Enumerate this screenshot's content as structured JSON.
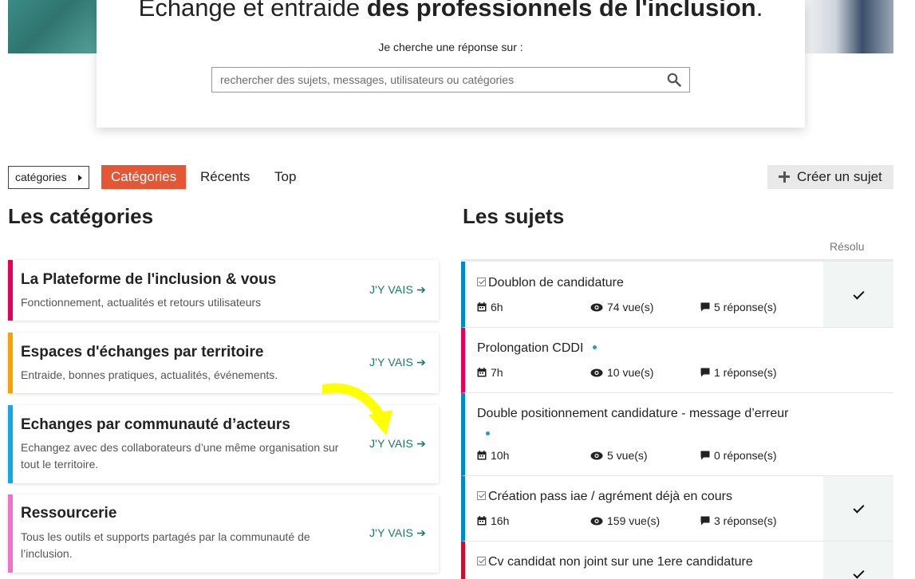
{
  "hero": {
    "title_prefix": "Echange et entraide ",
    "title_bold": "des professionnels de l'inclusion",
    "title_suffix": ".",
    "subtitle": "Je cherche une réponse sur :",
    "search_placeholder": "rechercher des sujets, messages, utilisateurs ou catégories"
  },
  "nav": {
    "dropdown_label": "catégories",
    "tabs": [
      {
        "label": "Catégories",
        "active": true
      },
      {
        "label": "Récents",
        "active": false
      },
      {
        "label": "Top",
        "active": false
      }
    ],
    "create_label": "Créer un sujet"
  },
  "categories_heading": "Les catégories",
  "topics_heading": "Les sujets",
  "solved_column_label": "Résolu",
  "categories": [
    {
      "title": "La Plateforme de l'inclusion & vous",
      "description": "Fonctionnement, actualités et retours utilisateurs",
      "go_label": "J'Y VAIS",
      "color": "#e5005b"
    },
    {
      "title": "Espaces d'échanges par territoire",
      "description": "Entraide, bonnes pratiques, actualités, événements.",
      "go_label": "J'Y VAIS",
      "color": "#f7a200"
    },
    {
      "title": "Echanges par communauté d’acteurs",
      "description": "Echangez avec des collaborateurs d’une même organisation sur tout le territoire.",
      "go_label": "J'Y VAIS",
      "color": "#12a8e0"
    },
    {
      "title": "Ressourcerie",
      "description": "Tous les outils et supports partagés par la communauté de l’inclusion.",
      "go_label": "J'Y VAIS",
      "color": "#f173c8"
    }
  ],
  "topics": [
    {
      "title": "Doublon de candidature",
      "solved": true,
      "unread_dot": false,
      "age": "6h",
      "views": "74 vue(s)",
      "replies": "5 réponse(s)",
      "color": "#0089c9"
    },
    {
      "title": "Prolongation CDDI",
      "solved": false,
      "unread_dot": true,
      "age": "7h",
      "views": "10 vue(s)",
      "replies": "1 réponse(s)",
      "color": "#e5005b"
    },
    {
      "title": "Double positionnement candidature - message d’erreur",
      "solved": false,
      "unread_dot": true,
      "age": "10h",
      "views": "5 vue(s)",
      "replies": "0 réponse(s)",
      "color": "#0089c9"
    },
    {
      "title": "Création pass iae / agrément déjà en cours",
      "solved": true,
      "unread_dot": false,
      "age": "16h",
      "views": "159 vue(s)",
      "replies": "3 réponse(s)",
      "color": "#0089c9"
    },
    {
      "title": "Cv candidat non joint sur une 1ere candidature",
      "solved": true,
      "unread_dot": false,
      "age": "",
      "views": "",
      "replies": "",
      "color": "#c8102e"
    }
  ],
  "colors": {
    "accent": "#e45735",
    "go_link": "#1a7a63",
    "annotation": "#ffff00"
  }
}
